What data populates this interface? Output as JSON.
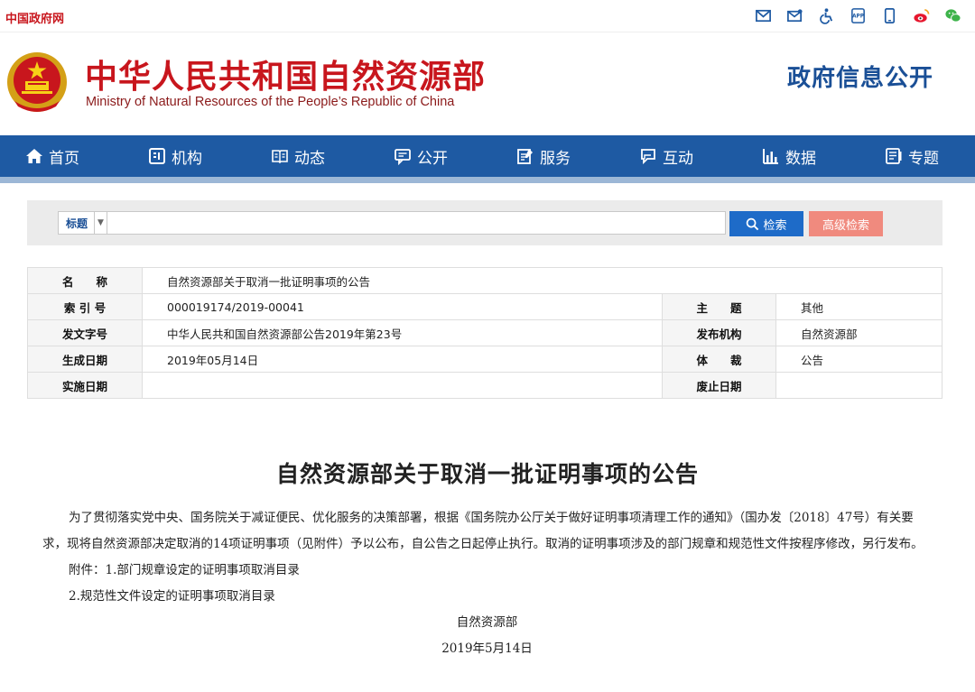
{
  "topbar": {
    "gov_link": "中国政府网",
    "icons": [
      "mail-icon",
      "mailbox-icon",
      "accessibility-icon",
      "app-icon",
      "mobile-icon",
      "weibo-icon",
      "wechat-icon"
    ]
  },
  "header": {
    "ministry_cn": "中华人民共和国自然资源部",
    "ministry_en": "Ministry of Natural Resources of the People’s Republic of China",
    "section_title": "政府信息公开"
  },
  "nav": {
    "items": [
      {
        "label": "首页",
        "icon": "home-icon"
      },
      {
        "label": "机构",
        "icon": "org-icon"
      },
      {
        "label": "动态",
        "icon": "book-icon"
      },
      {
        "label": "公开",
        "icon": "chat-icon"
      },
      {
        "label": "服务",
        "icon": "service-icon"
      },
      {
        "label": "互动",
        "icon": "interact-icon"
      },
      {
        "label": "数据",
        "icon": "chart-icon"
      },
      {
        "label": "专题",
        "icon": "topic-icon"
      }
    ]
  },
  "search": {
    "field_select": "标题",
    "query": "",
    "search_label": "检索",
    "advanced_label": "高级检索"
  },
  "meta": {
    "name_label": "名　　称",
    "name_value": "自然资源部关于取消一批证明事项的公告",
    "index_label": "索 引 号",
    "index_value": "000019174/2019-00041",
    "subject_label": "主　　题",
    "subject_value": "其他",
    "doc_no_label": "发文字号",
    "doc_no_value": "中华人民共和国自然资源部公告2019年第23号",
    "publisher_label": "发布机构",
    "publisher_value": "自然资源部",
    "created_label": "生成日期",
    "created_value": "2019年05月14日",
    "genre_label": "体　　裁",
    "genre_value": "公告",
    "effective_label": "实施日期",
    "effective_value": "",
    "expired_label": "废止日期",
    "expired_value": ""
  },
  "article": {
    "title": "自然资源部关于取消一批证明事项的公告",
    "para1": "为了贯彻落实党中央、国务院关于减证便民、优化服务的决策部署，根据《国务院办公厅关于做好证明事项清理工作的通知》（国办发〔2018〕47号）有关要求，现将自然资源部决定取消的14项证明事项（见附件）予以公布，自公告之日起停止执行。取消的证明事项涉及的部门规章和规范性文件按程序修改，另行发布。",
    "attach1": "附件：1.部门规章设定的证明事项取消目录",
    "attach2": "2.规范性文件设定的证明事项取消目录",
    "signer": "自然资源部",
    "date": "2019年5月14日"
  }
}
